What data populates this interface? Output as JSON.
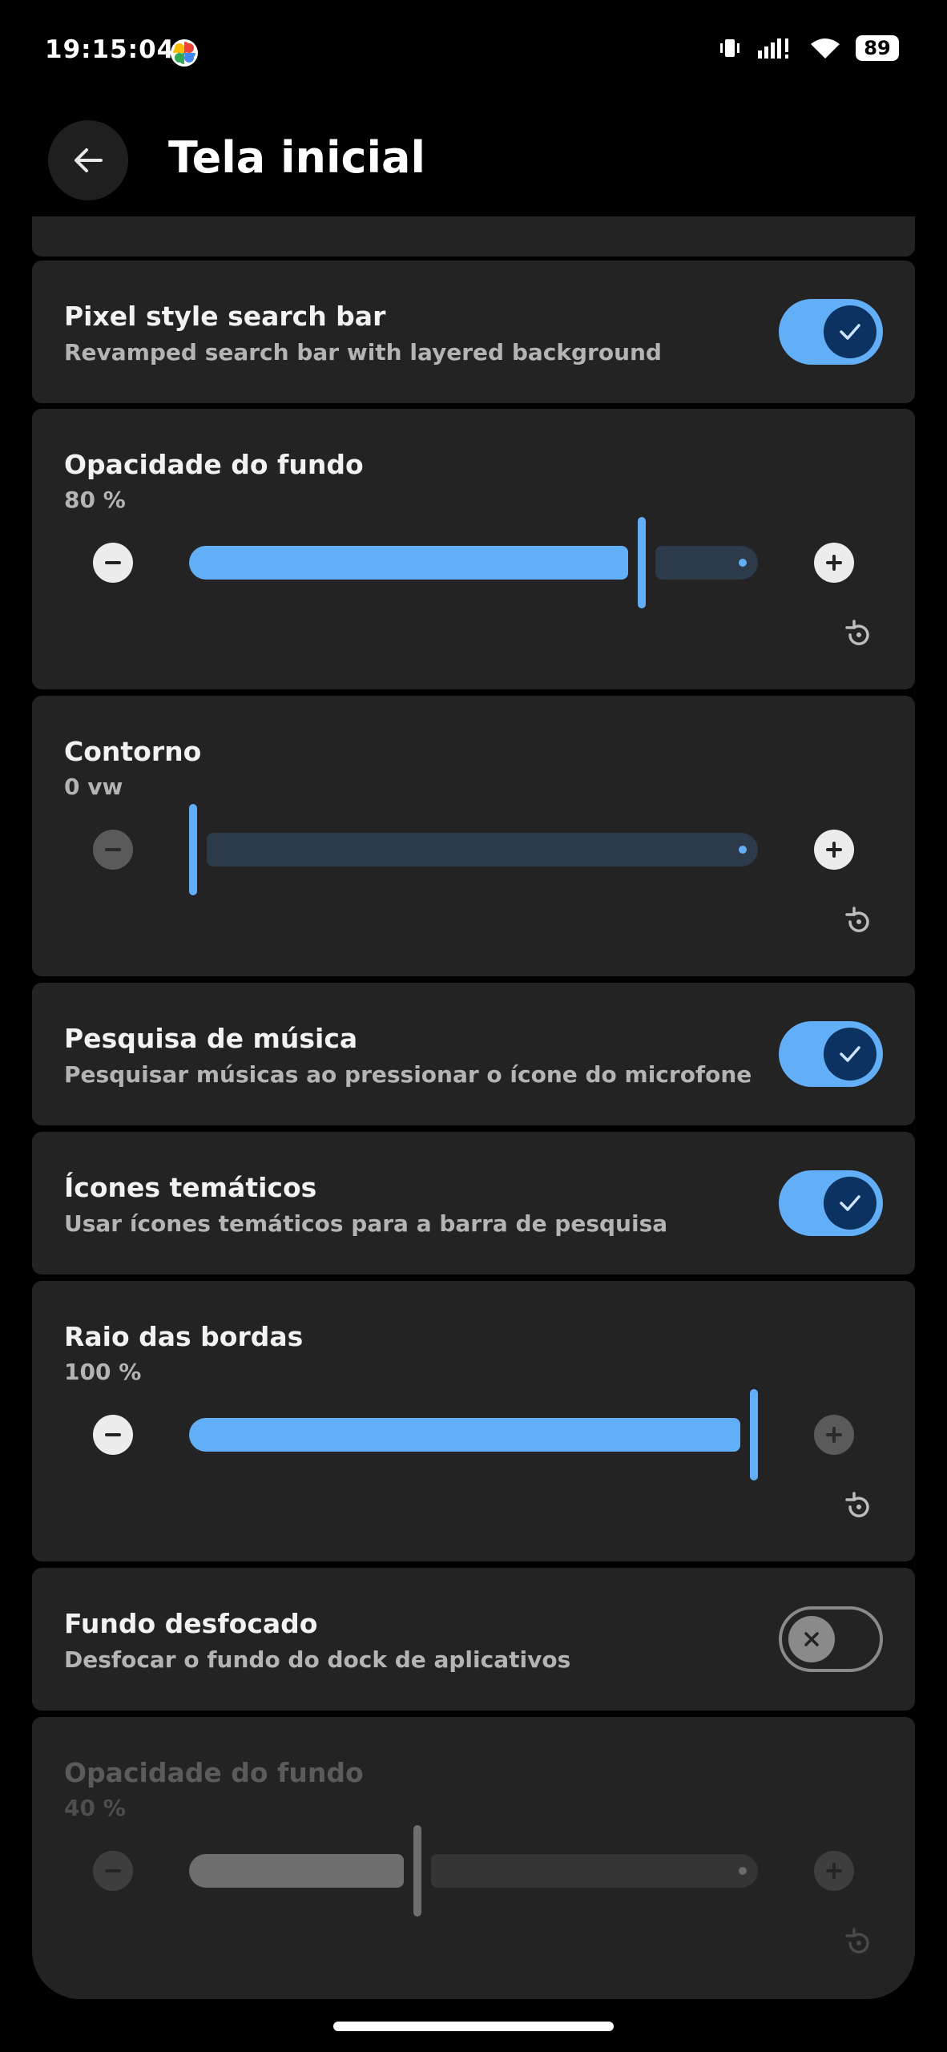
{
  "status_bar": {
    "time": "19:15:04",
    "battery": "89",
    "icons": [
      "google-photos-icon",
      "vibrate-icon",
      "signal-icon",
      "wifi-icon",
      "battery-icon"
    ]
  },
  "header": {
    "title": "Tela inicial",
    "back_icon": "arrow-left-icon"
  },
  "settings": {
    "pixel_search": {
      "title": "Pixel style search bar",
      "subtitle": "Revamped search bar with layered background",
      "enabled": true
    },
    "bg_opacity": {
      "title": "Opacidade do fundo",
      "value": "80 %",
      "fraction": 0.8
    },
    "outline": {
      "title": "Contorno",
      "value": "0 vw",
      "fraction": 0.0
    },
    "music_search": {
      "title": "Pesquisa de música",
      "subtitle": "Pesquisar músicas ao pressionar o ícone do microfone",
      "enabled": true
    },
    "themed_icons": {
      "title": "Ícones temáticos",
      "subtitle": "Usar ícones temáticos para a barra de pesquisa",
      "enabled": true
    },
    "corner_radius": {
      "title": "Raio das bordas",
      "value": "100 %",
      "fraction": 1.0
    },
    "blur_bg": {
      "title": "Fundo desfocado",
      "subtitle": "Desfocar o fundo do dock de aplicativos",
      "enabled": false
    },
    "dock_opacity": {
      "title": "Opacidade do fundo",
      "value": "40 %",
      "fraction": 0.4,
      "disabled": true
    }
  },
  "colors": {
    "accent": "#62aef7",
    "track_inactive": "#2d3a49",
    "card": "#232323",
    "disabled_active": "#6e6e6e",
    "disabled_inactive": "#353535"
  }
}
